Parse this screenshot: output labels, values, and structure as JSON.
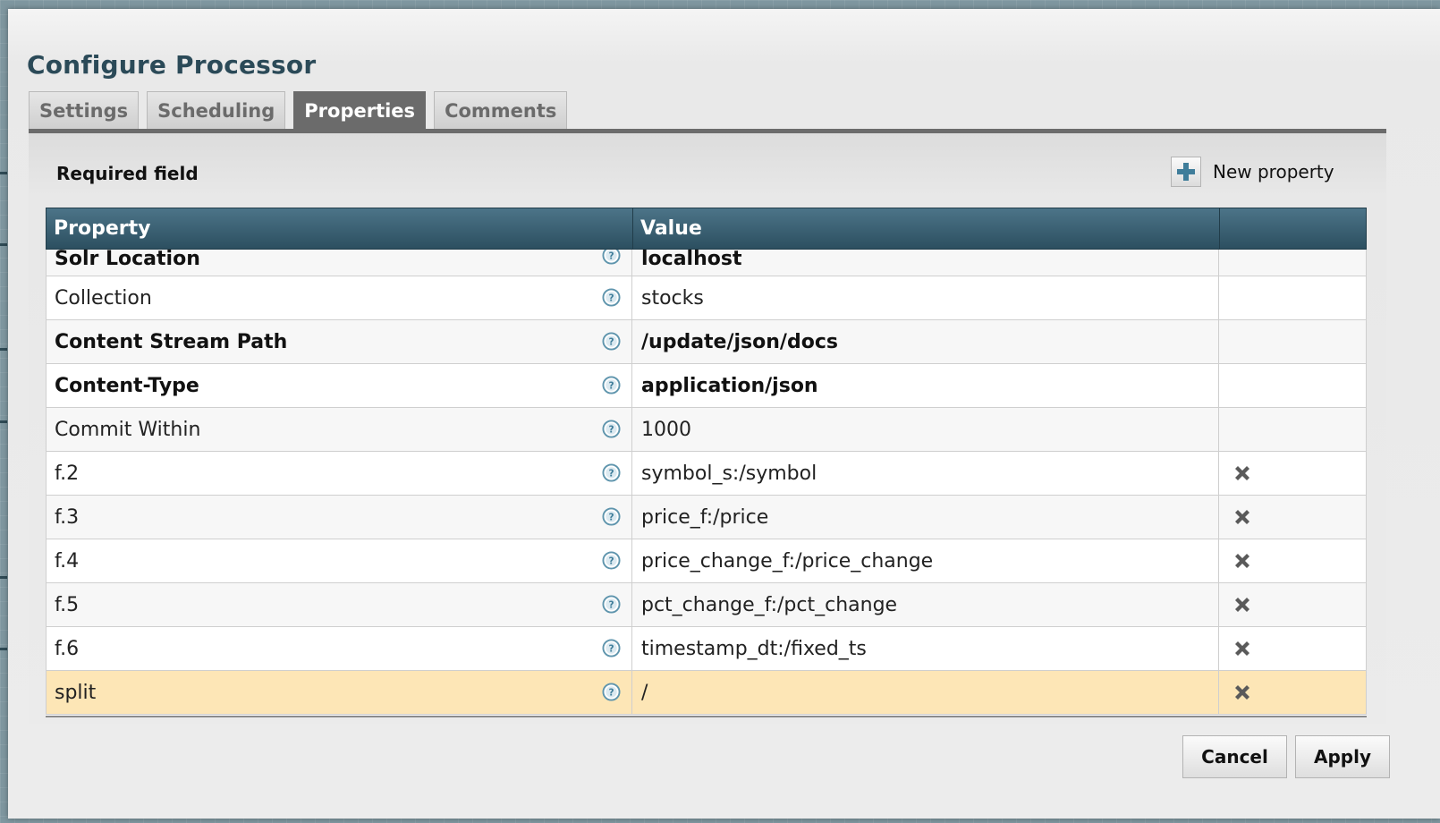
{
  "dialog": {
    "title": "Configure Processor"
  },
  "tabs": [
    {
      "label": "Settings",
      "active": false
    },
    {
      "label": "Scheduling",
      "active": false
    },
    {
      "label": "Properties",
      "active": true
    },
    {
      "label": "Comments",
      "active": false
    }
  ],
  "properties_panel": {
    "required_label": "Required field",
    "new_property_label": "New property",
    "new_property_icon": "plus-icon",
    "columns": [
      "Property",
      "Value",
      ""
    ],
    "rows": [
      {
        "property": "Solr Location",
        "value": "localhost",
        "required": true,
        "deletable": false
      },
      {
        "property": "Collection",
        "value": "stocks",
        "required": false,
        "deletable": false
      },
      {
        "property": "Content Stream Path",
        "value": "/update/json/docs",
        "required": true,
        "deletable": false
      },
      {
        "property": "Content-Type",
        "value": "application/json",
        "required": true,
        "deletable": false
      },
      {
        "property": "Commit Within",
        "value": "1000",
        "required": false,
        "deletable": false
      },
      {
        "property": "f.2",
        "value": "symbol_s:/symbol",
        "required": false,
        "deletable": true
      },
      {
        "property": "f.3",
        "value": "price_f:/price",
        "required": false,
        "deletable": true
      },
      {
        "property": "f.4",
        "value": "price_change_f:/price_change",
        "required": false,
        "deletable": true
      },
      {
        "property": "f.5",
        "value": "pct_change_f:/pct_change",
        "required": false,
        "deletable": true
      },
      {
        "property": "f.6",
        "value": "timestamp_dt:/fixed_ts",
        "required": false,
        "deletable": true
      },
      {
        "property": "split",
        "value": "/",
        "required": false,
        "deletable": true,
        "selected": true
      }
    ]
  },
  "buttons": {
    "cancel": "Cancel",
    "apply": "Apply"
  },
  "colors": {
    "header_blue": "#2c4f60",
    "title_blue": "#2b4a58",
    "selected_row": "#fde6b6",
    "active_tab": "#6b6b6b"
  }
}
